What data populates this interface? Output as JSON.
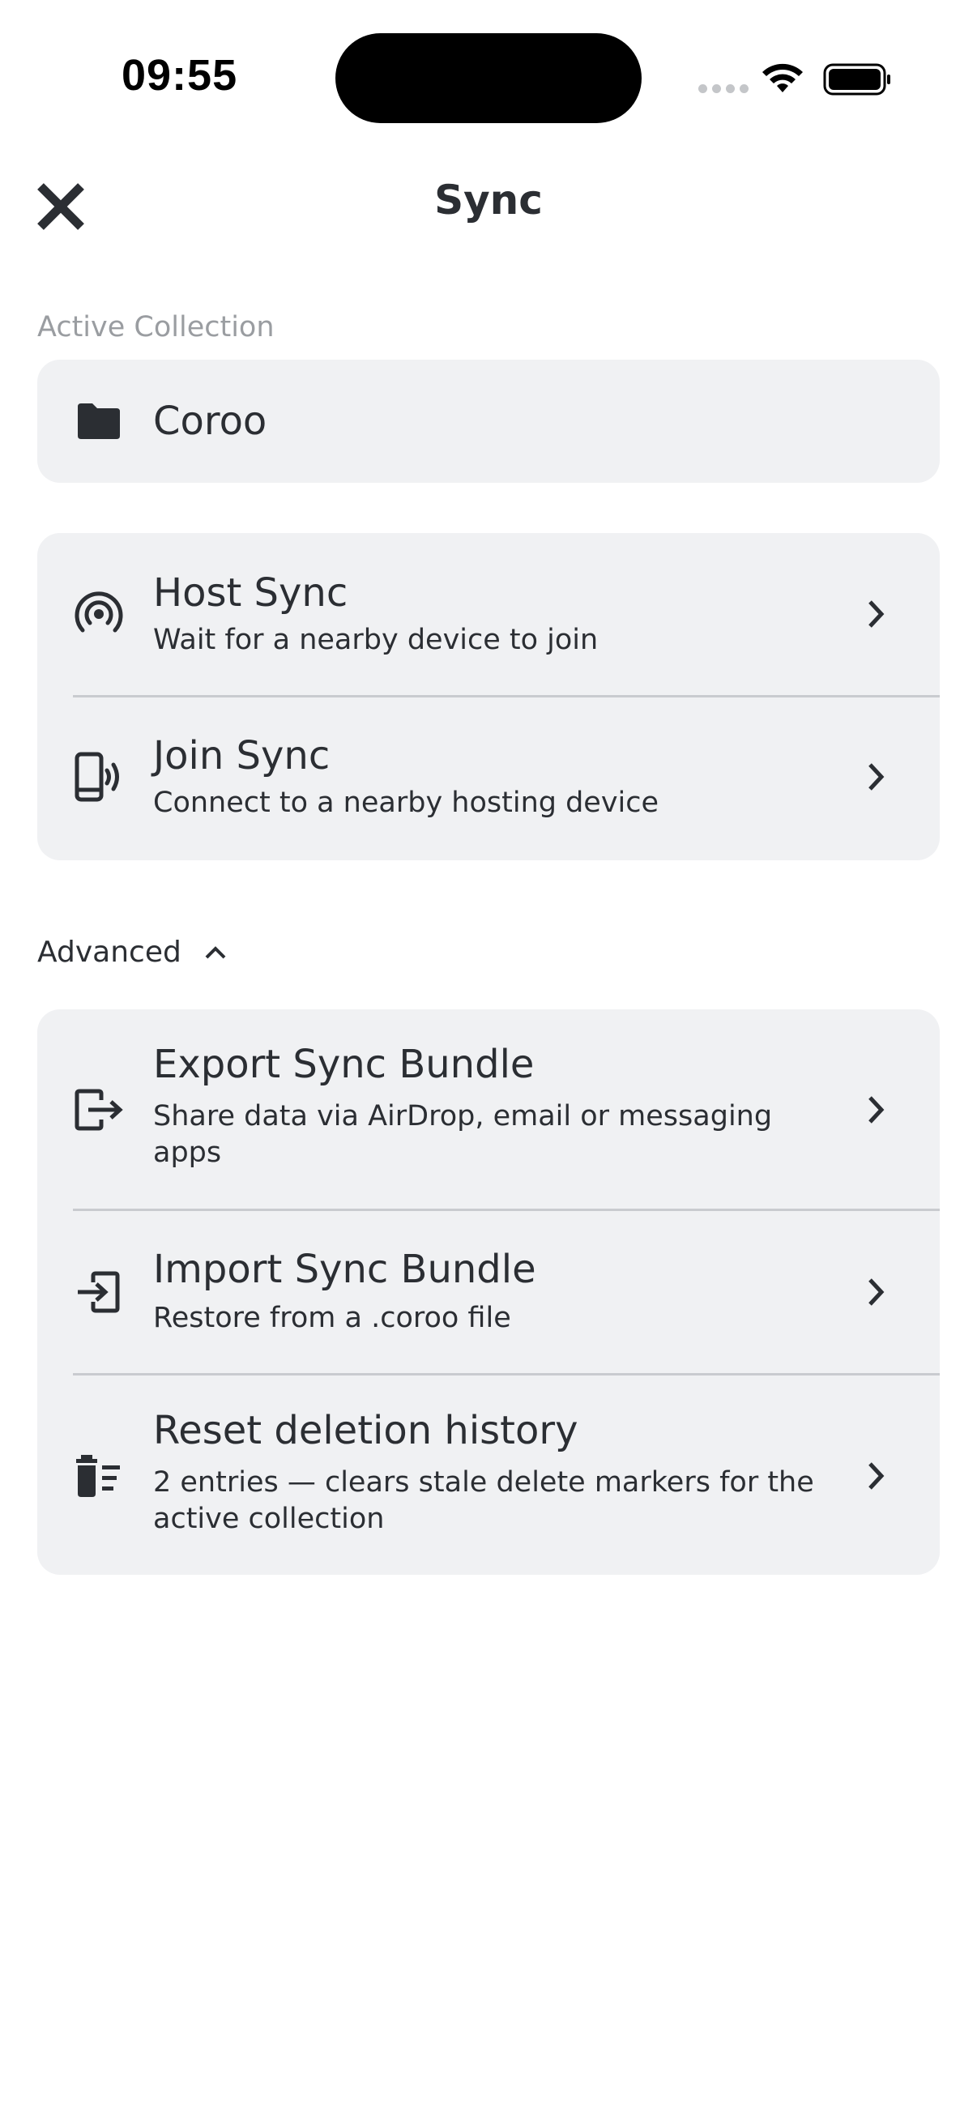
{
  "status_bar": {
    "time": "09:55"
  },
  "header": {
    "title": "Sync",
    "close_icon": "close-icon"
  },
  "active_collection": {
    "label": "Active Collection",
    "name": "Coroo",
    "icon": "folder-icon"
  },
  "sync_options": [
    {
      "title": "Host Sync",
      "subtitle": "Wait for a nearby device to join",
      "icon": "broadcast-icon"
    },
    {
      "title": "Join Sync",
      "subtitle": "Connect to a nearby hosting device",
      "icon": "phone-signal-icon"
    }
  ],
  "advanced": {
    "label": "Advanced",
    "expanded": true,
    "items": [
      {
        "title": "Export Sync Bundle",
        "subtitle": "Share data via AirDrop, email or messaging apps",
        "icon": "export-icon"
      },
      {
        "title": "Import Sync Bundle",
        "subtitle": "Restore from a .coroo file",
        "icon": "import-icon"
      },
      {
        "title": "Reset deletion history",
        "subtitle": "2 entries — clears stale delete markers for the active collection",
        "icon": "delete-sweep-icon"
      }
    ]
  }
}
